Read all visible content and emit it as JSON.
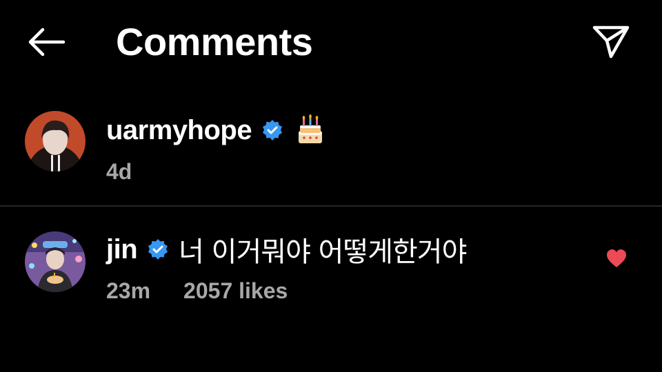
{
  "header": {
    "title": "Comments",
    "back_icon": "arrow-left-icon",
    "send_icon": "paper-plane-icon"
  },
  "comments": [
    {
      "username": "uarmyhope",
      "verified": true,
      "text": "🎂",
      "time": "4d"
    },
    {
      "username": "jin",
      "verified": true,
      "text": "너 이거뭐야 어떻게한거야",
      "time": "23m",
      "likes": "2057 likes",
      "liked": true
    }
  ],
  "colors": {
    "background": "#000000",
    "verified_badge": "#3897F0",
    "heart": "#ED4956",
    "secondary_text": "#A8A8A8"
  }
}
